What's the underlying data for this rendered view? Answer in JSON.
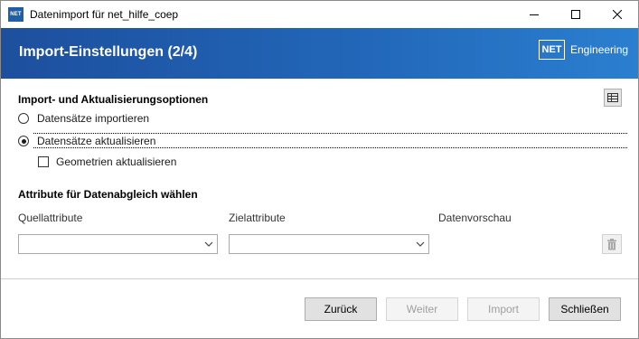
{
  "window": {
    "title": "Datenimport für net_hilfe_coep",
    "icon_text": "NET"
  },
  "banner": {
    "title": "Import-Einstellungen (2/4)",
    "logo_box": "NET",
    "logo_text": "Engineering"
  },
  "options": {
    "heading": "Import- und Aktualisierungsoptionen",
    "radio_import": "Datensätze importieren",
    "radio_update": "Datensätze aktualisieren",
    "selected": "update",
    "checkbox_geometry": "Geometrien aktualisieren",
    "checkbox_geometry_checked": false
  },
  "matching": {
    "heading": "Attribute für Datenabgleich wählen",
    "source_label": "Quellattribute",
    "target_label": "Zielattribute",
    "preview_label": "Datenvorschau",
    "source_value": "",
    "target_value": ""
  },
  "buttons": {
    "back": "Zurück",
    "next": "Weiter",
    "import": "Import",
    "close": "Schließen"
  },
  "icons": {
    "table": "table-icon",
    "trash": "trash-icon",
    "chevron": "chevron-down-icon"
  }
}
